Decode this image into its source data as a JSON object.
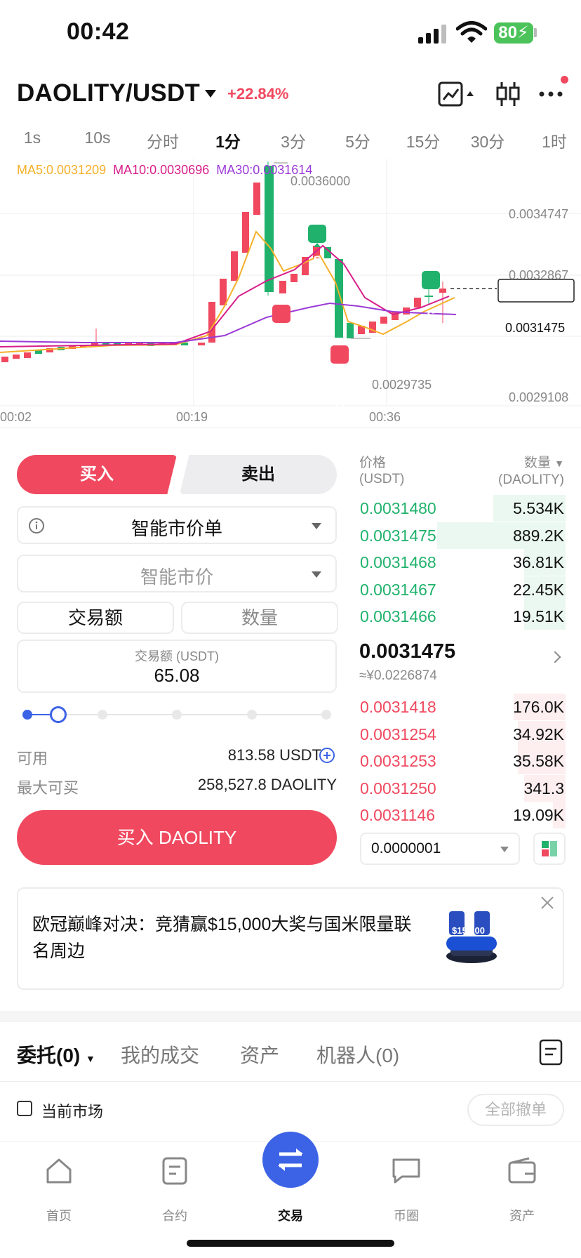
{
  "status": {
    "time": "00:42",
    "battery": "80"
  },
  "header": {
    "pair": "DAOLITY/USDT",
    "change": "+22.84%"
  },
  "timeframes": [
    "1s",
    "10s",
    "分时",
    "1分",
    "3分",
    "5分",
    "15分",
    "30分",
    "1时"
  ],
  "timeframe_active": "1分",
  "chart": {
    "ma5": "MA5:0.0031209",
    "ma10": "MA10:0.0030696",
    "ma30": "MA30:0.0031614",
    "high_label": "0.0036000",
    "low_label": "0.0029735",
    "price_axis": [
      "0.0034747",
      "0.0032867",
      "0.0031475",
      "0.0029108"
    ],
    "time_axis": [
      "00:02",
      "00:19",
      "00:36"
    ],
    "marker_buy": "B",
    "marker_sell": "S"
  },
  "order_form": {
    "buy_tab": "买入",
    "sell_tab": "卖出",
    "order_type": "智能市价单",
    "price_mode": "智能市价",
    "mode_amount": "交易额",
    "mode_qty": "数量",
    "amount_label": "交易额 (USDT)",
    "amount_value": "65.08",
    "available_label": "可用",
    "available_value": "813.58 USDT",
    "max_label": "最大可买",
    "max_value": "258,527.8 DAOLITY",
    "submit": "买入 DAOLITY",
    "slider_fraction": 0.1
  },
  "orderbook": {
    "price_head": "价格",
    "price_unit": "(USDT)",
    "qty_head": "数量",
    "qty_unit": "(DAOLITY)",
    "asks": [
      {
        "price": "0.0031480",
        "qty": "5.534K",
        "depth": 0.35
      },
      {
        "price": "0.0031475",
        "qty": "889.2K",
        "depth": 0.62
      },
      {
        "price": "0.0031468",
        "qty": "36.81K",
        "depth": 0.2
      },
      {
        "price": "0.0031467",
        "qty": "22.45K",
        "depth": 0.2
      },
      {
        "price": "0.0031466",
        "qty": "19.51K",
        "depth": 0.2
      }
    ],
    "last_price": "0.0031475",
    "last_cny": "≈¥0.0226874",
    "bids": [
      {
        "price": "0.0031418",
        "qty": "176.0K",
        "depth": 0.25
      },
      {
        "price": "0.0031254",
        "qty": "34.92K",
        "depth": 0.23
      },
      {
        "price": "0.0031253",
        "qty": "35.58K",
        "depth": 0.23
      },
      {
        "price": "0.0031250",
        "qty": "341.3",
        "depth": 0.2
      },
      {
        "price": "0.0031146",
        "qty": "19.09K",
        "depth": 0.06
      }
    ],
    "precision": "0.0000001"
  },
  "banner": {
    "text": "欧冠巅峰对决：竞猜赢$15,000大奖与国米限量联名周边",
    "badge": "$15,000"
  },
  "orders": {
    "tabs": [
      "委托(0)",
      "我的成交",
      "资产",
      "机器人(0)"
    ],
    "current_market": "当前市场",
    "cancel_all": "全部撤单"
  },
  "nav": [
    "首页",
    "合约",
    "交易",
    "币圈",
    "资产"
  ],
  "colors": {
    "red": "#f0495f",
    "green": "#20b26c",
    "blue": "#3c63e6",
    "ma5": "#f5b02a",
    "ma10": "#d81e8a",
    "ma30": "#9b3bd6"
  }
}
